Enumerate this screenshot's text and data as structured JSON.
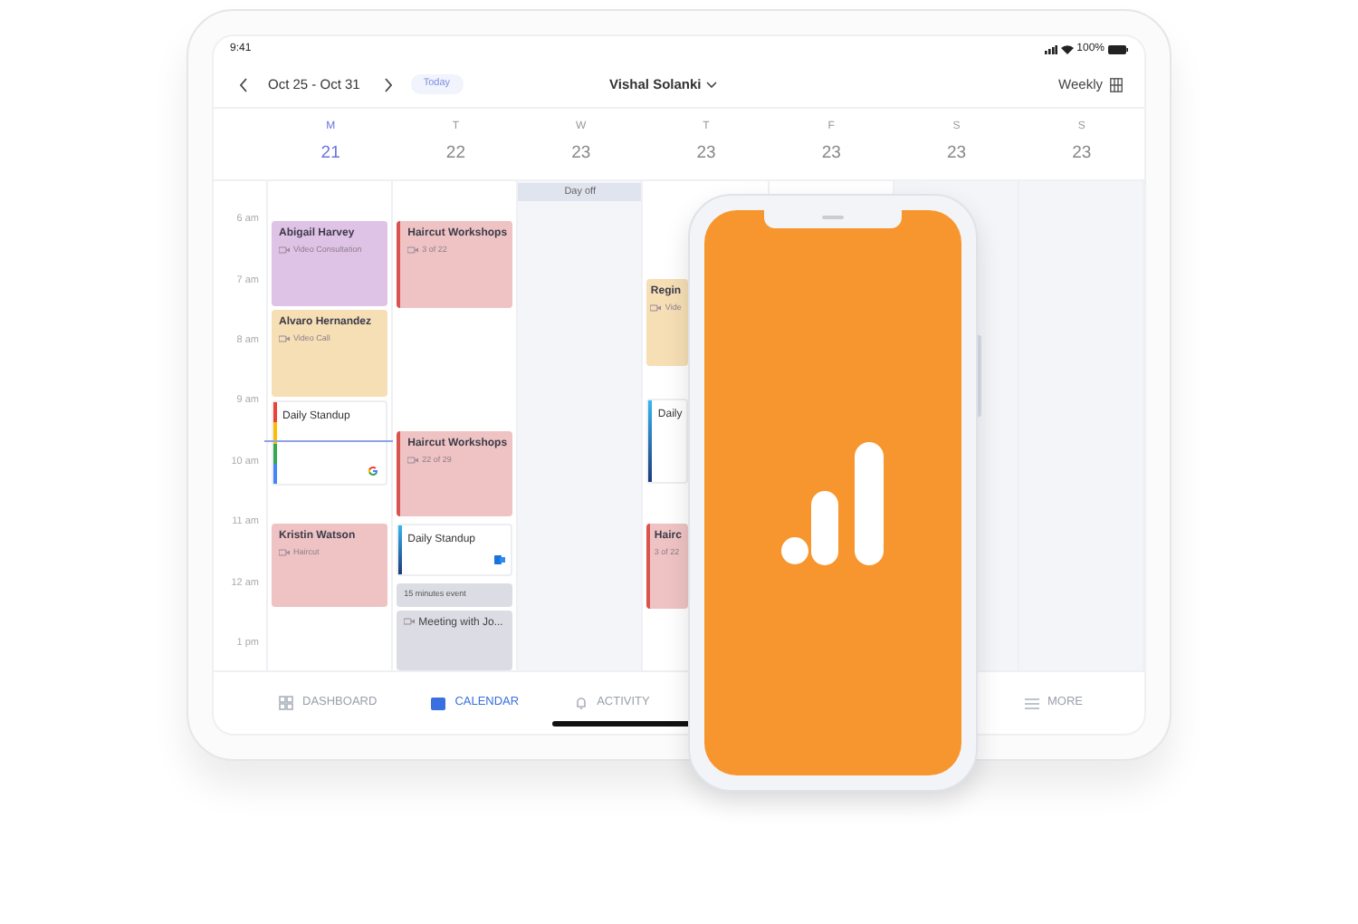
{
  "status_bar": {
    "time": "9:41",
    "battery": "100%"
  },
  "header": {
    "date_range": "Oct 25 - Oct 31",
    "today": "Today",
    "user": "Vishal Solanki",
    "view": "Weekly"
  },
  "now_line": true,
  "hours": [
    "6 am",
    "7 am",
    "8 am",
    "9 am",
    "10 am",
    "11 am",
    "12 am",
    "1 pm"
  ],
  "days": [
    {
      "letter": "M",
      "date": "21",
      "selected": true,
      "shaded": false,
      "events": [
        {
          "kind": "block",
          "title": "Abigail Harvey",
          "subtitle": "Video Consultation",
          "color": "#dfc3e6",
          "accent": false,
          "icon": true
        },
        {
          "kind": "block",
          "title": "Alvaro Hernandez",
          "subtitle": "Video Call",
          "color": "#f6dfb5",
          "accent": false,
          "icon": true
        },
        {
          "kind": "google",
          "title": "Daily Standup"
        },
        {
          "kind": "block",
          "title": "Kristin Watson",
          "subtitle": "Haircut",
          "color": "#efc3c3",
          "accent": false,
          "icon": true
        }
      ]
    },
    {
      "letter": "T",
      "date": "22",
      "selected": false,
      "shaded": false,
      "events": [
        {
          "kind": "block",
          "title": "Haircut Workshops",
          "subtitle": "3 of 22",
          "color": "#efc3c3",
          "accent": true,
          "icon": true
        },
        {
          "kind": "block",
          "title": "Haircut Workshops",
          "subtitle": "22 of 29",
          "color": "#efc3c3",
          "accent": true,
          "icon": true
        },
        {
          "kind": "calendar_app",
          "title": "Daily Standup"
        },
        {
          "kind": "note",
          "title": "15 minutes event"
        },
        {
          "kind": "meeting",
          "title": "Meeting with Jo..."
        }
      ]
    },
    {
      "letter": "W",
      "date": "23",
      "selected": false,
      "shaded": true,
      "banner": "Day off"
    },
    {
      "letter": "T",
      "date": "23",
      "selected": false,
      "shaded": false,
      "events": [
        {
          "kind": "block",
          "title": "Regin",
          "subtitle": "Vide",
          "color": "#f6dfb5",
          "accent": false,
          "icon": true
        },
        {
          "kind": "plain_sync",
          "title": "Daily"
        },
        {
          "kind": "block",
          "title": "Hairc",
          "subtitle": "3 of 22",
          "color": "#efc3c3",
          "accent": true,
          "icon": false
        }
      ]
    },
    {
      "letter": "F",
      "date": "23",
      "selected": false,
      "shaded": false
    },
    {
      "letter": "S",
      "date": "23",
      "selected": false,
      "shaded": true
    },
    {
      "letter": "S",
      "date": "23",
      "selected": false,
      "shaded": true
    }
  ],
  "nav": [
    {
      "label": "DASHBOARD",
      "selected": false
    },
    {
      "label": "CALENDAR",
      "selected": true
    },
    {
      "label": "ACTIVITY",
      "selected": false
    },
    {
      "label": "MORE",
      "selected": false
    }
  ]
}
